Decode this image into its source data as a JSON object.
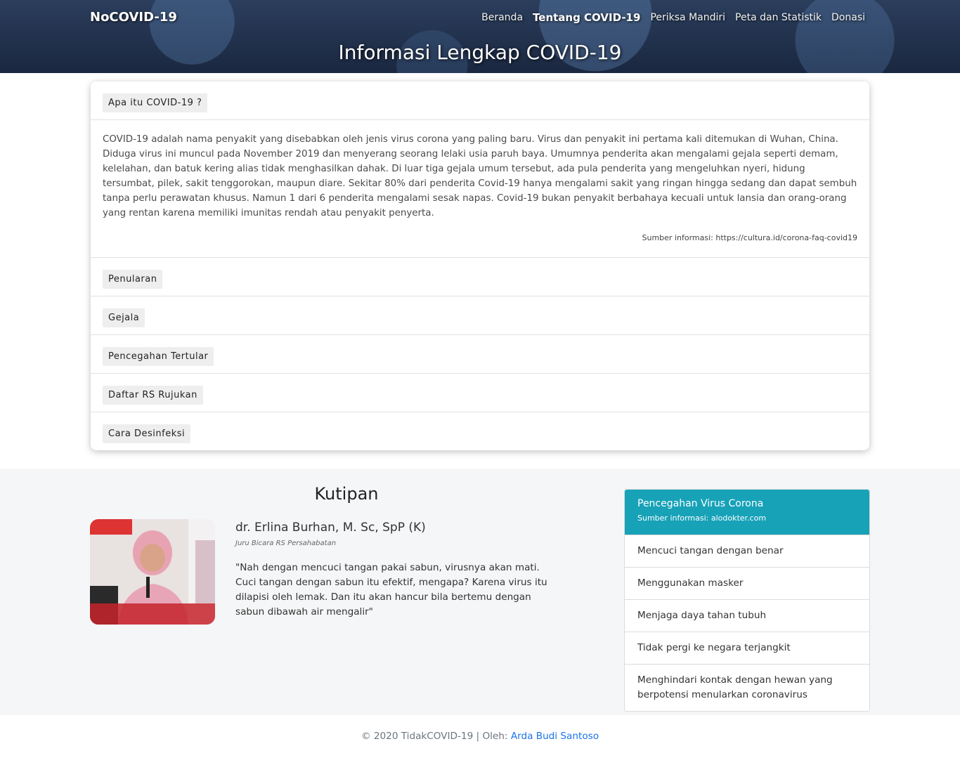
{
  "header": {
    "brand": "NoCOVID-19",
    "nav": [
      "Beranda",
      "Tentang COVID-19",
      "Periksa Mandiri",
      "Peta dan Statistik",
      "Donasi"
    ],
    "active_nav": "Tentang COVID-19",
    "title": "Informasi Lengkap COVID-19"
  },
  "accordion": {
    "items": [
      {
        "label": "Apa itu COVID-19 ?"
      },
      {
        "label": "Penularan"
      },
      {
        "label": "Gejala"
      },
      {
        "label": "Pencegahan Tertular"
      },
      {
        "label": "Daftar RS Rujukan"
      },
      {
        "label": "Cara Desinfeksi"
      }
    ],
    "open_text": "COVID-19 adalah nama penyakit yang disebabkan oleh jenis virus corona yang paling baru. Virus dan penyakit ini pertama kali ditemukan di Wuhan, China. Diduga virus ini muncul pada November 2019 dan menyerang seorang lelaki usia paruh baya. Umumnya penderita akan mengalami gejala seperti demam, kelelahan, dan batuk kering alias tidak menghasilkan dahak. Di luar tiga gejala umum tersebut, ada pula penderita yang mengeluhkan nyeri, hidung tersumbat, pilek, sakit tenggorokan, maupun diare. Sekitar 80% dari penderita Covid-19 hanya mengalami sakit yang ringan hingga sedang dan dapat sembuh tanpa perlu perawatan khusus. Namun 1 dari 6 penderita mengalami sesak napas. Covid-19 bukan penyakit berbahaya kecuali untuk lansia dan orang-orang yang rentan karena memiliki imunitas rendah atau penyakit penyerta.",
    "open_source": "Sumber informasi: https://cultura.id/corona-faq-covid19"
  },
  "quote": {
    "title": "Kutipan",
    "name": "dr. Erlina Burhan, M. Sc, SpP (K)",
    "role": "Juru Bicara RS Persahabatan",
    "text": "\"Nah dengan mencuci tangan pakai sabun, virusnya akan mati. Cuci tangan dengan sabun itu efektif, mengapa? Karena virus itu dilapisi oleh lemak. Dan itu akan hancur bila bertemu dengan sabun dibawah air mengalir\""
  },
  "prevention": {
    "title": "Pencegahan Virus Corona",
    "source": "Sumber informasi: alodokter.com",
    "items": [
      "Mencuci tangan dengan benar",
      "Menggunakan masker",
      "Menjaga daya tahan tubuh",
      "Tidak pergi ke negara terjangkit",
      "Menghindari kontak dengan hewan yang berpotensi menularkan coronavirus"
    ]
  },
  "footer": {
    "text": "© 2020 TidakCOVID-19 | Oleh: ",
    "author": "Arda Budi Santoso"
  },
  "colors": {
    "header_bg": "#1f2f4a",
    "list_header": "#17a2b8",
    "link": "#1a73e8",
    "quote_section_bg": "#f5f6f7"
  }
}
